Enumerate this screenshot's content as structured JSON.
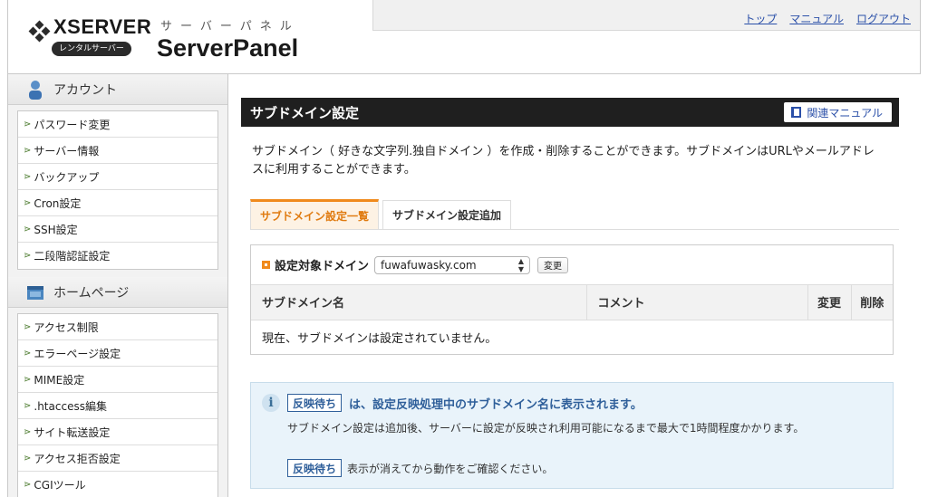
{
  "header": {
    "logo_text": "XSERVER",
    "logo_badge": "レンタルサーバー",
    "panel_subtitle": "サーバーパネル",
    "panel_title": "ServerPanel",
    "nav": [
      "トップ",
      "マニュアル",
      "ログアウト"
    ]
  },
  "sidebar": {
    "sections": [
      {
        "title": "アカウント",
        "items": [
          "パスワード変更",
          "サーバー情報",
          "バックアップ",
          "Cron設定",
          "SSH設定",
          "二段階認証設定"
        ]
      },
      {
        "title": "ホームページ",
        "items": [
          "アクセス制限",
          "エラーページ設定",
          "MIME設定",
          ".htaccess編集",
          "サイト転送設定",
          "アクセス拒否設定",
          "CGIツール"
        ]
      }
    ]
  },
  "main": {
    "title": "サブドメイン設定",
    "manual_button": "関連マニュアル",
    "description": "サブドメイン（ 好きな文字列.独自ドメイン ）を作成・削除することができます。サブドメインはURLやメールアドレスに利用することができます。",
    "tabs": [
      {
        "label": "サブドメイン設定一覧",
        "active": true
      },
      {
        "label": "サブドメイン設定追加",
        "active": false
      }
    ],
    "filter": {
      "label": "設定対象ドメイン",
      "selected_domain": "fuwafuwasky.com",
      "change_button": "変更"
    },
    "table": {
      "columns": [
        "サブドメイン名",
        "コメント",
        "変更",
        "削除"
      ],
      "empty_message": "現在、サブドメインは設定されていません。"
    },
    "info": {
      "badge": "反映待ち",
      "headline": "は、設定反映処理中のサブドメイン名に表示されます。",
      "body": "サブドメイン設定は追加後、サーバーに設定が反映され利用可能になるまで最大で1時間程度かかります。",
      "footer_text": "表示が消えてから動作をご確認ください。"
    }
  }
}
